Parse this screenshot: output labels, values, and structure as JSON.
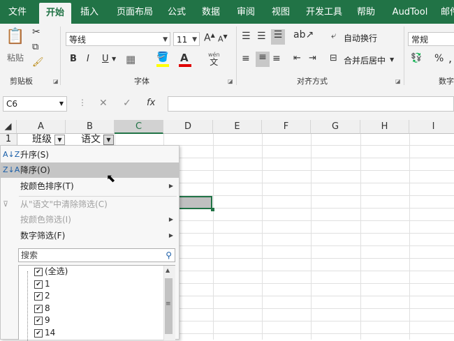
{
  "tabs": [
    "文件",
    "开始",
    "插入",
    "页面布局",
    "公式",
    "数据",
    "审阅",
    "视图",
    "开发工具",
    "帮助",
    "AudTool",
    "邮件"
  ],
  "ribbon": {
    "clipboard": {
      "paste_label": "粘贴",
      "group_label": "剪贴板"
    },
    "font": {
      "font_name": "等线",
      "font_size": "11",
      "bold": "B",
      "italic": "I",
      "underline": "U",
      "font_color_letter": "A",
      "grow_letter": "A",
      "shrink_letter": "A",
      "wen_label": "wén",
      "wen_char": "文",
      "group_label": "字体"
    },
    "alignment": {
      "wrap_text": "自动换行",
      "merge_center": "合并后居中",
      "group_label": "对齐方式"
    },
    "number": {
      "format": "常规",
      "percent": "%",
      "comma": ",",
      "group_label": "数字"
    }
  },
  "formula_bar": {
    "name_box": "C6",
    "cancel": "✕",
    "enter": "✓",
    "fx": "fx",
    "value": ""
  },
  "columns": [
    "A",
    "B",
    "C",
    "D",
    "E",
    "F",
    "G",
    "H",
    "I"
  ],
  "rows": [
    "1"
  ],
  "cells": {
    "A1": "班级",
    "B1": "语文"
  },
  "menu": {
    "sort_asc": "升序(S)",
    "sort_desc": "降序(O)",
    "sort_by_color": "按颜色排序(T)",
    "clear_filter": "从\"语文\"中清除筛选(C)",
    "filter_by_color": "按颜色筛选(I)",
    "number_filter": "数字筛选(F)",
    "search_placeholder": "搜索",
    "values": [
      "(全选)",
      "1",
      "2",
      "8",
      "9",
      "14"
    ]
  },
  "colors": {
    "accent": "#217346",
    "ribbon_bg": "#f3f3f3"
  }
}
